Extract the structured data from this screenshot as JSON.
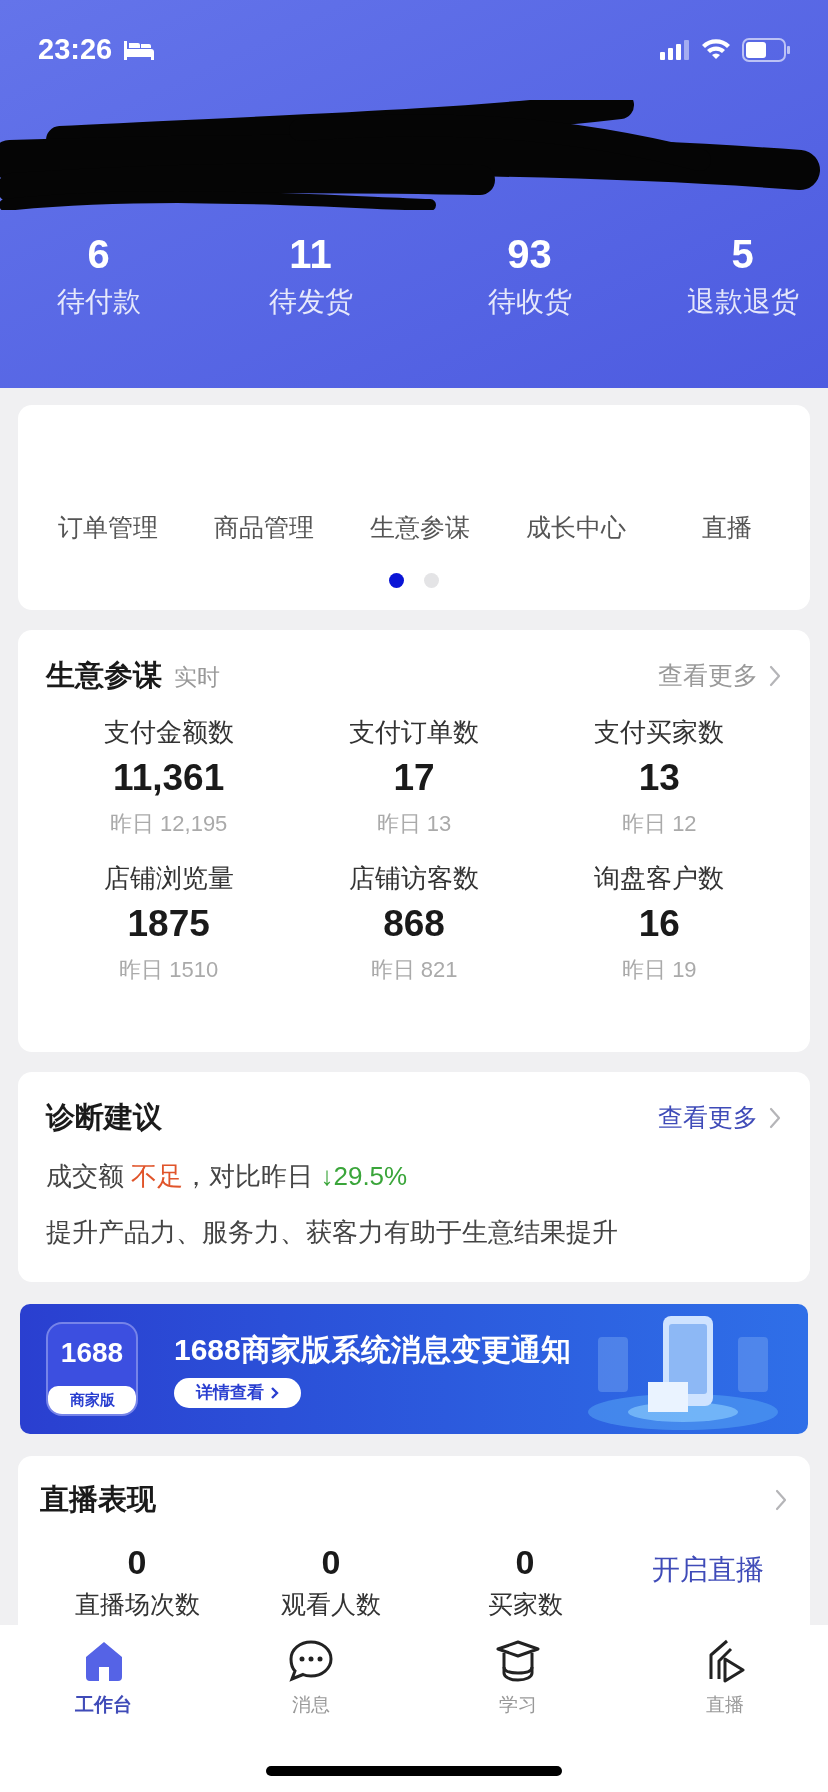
{
  "status_bar": {
    "time": "23:26"
  },
  "order_stats": [
    {
      "value": "6",
      "label": "待付款"
    },
    {
      "value": "11",
      "label": "待发货"
    },
    {
      "value": "93",
      "label": "待收货"
    },
    {
      "value": "5",
      "label": "退款退货"
    }
  ],
  "shortcuts": {
    "items": [
      "订单管理",
      "商品管理",
      "生意参谋",
      "成长中心",
      "直播"
    ],
    "pages": [
      {
        "selected": true
      },
      {
        "selected": false
      }
    ]
  },
  "business_advisor": {
    "title": "生意参谋",
    "badge": "实时",
    "more": "查看更多",
    "metrics": [
      {
        "label": "支付金额数",
        "value": "11,361",
        "yesterday": "昨日 12,195"
      },
      {
        "label": "支付订单数",
        "value": "17",
        "yesterday": "昨日 13"
      },
      {
        "label": "支付买家数",
        "value": "13",
        "yesterday": "昨日 12"
      },
      {
        "label": "店铺浏览量",
        "value": "1875",
        "yesterday": "昨日 1510"
      },
      {
        "label": "店铺访客数",
        "value": "868",
        "yesterday": "昨日 821"
      },
      {
        "label": "询盘客户数",
        "value": "16",
        "yesterday": "昨日 19"
      }
    ]
  },
  "diagnosis": {
    "title": "诊断建议",
    "more": "查看更多",
    "metric": "成交额",
    "status": "不足",
    "compare": "，对比昨日",
    "change": "↓29.5%",
    "advice": "提升产品力、服务力、获客力有助于生意结果提升"
  },
  "banner": {
    "logo_number": "1688",
    "logo_caption": "商家版",
    "title": "1688商家版系统消息变更通知",
    "button": "详情查看"
  },
  "live": {
    "title": "直播表现",
    "metrics": [
      {
        "value": "0",
        "label": "直播场次数"
      },
      {
        "value": "0",
        "label": "观看人数"
      },
      {
        "value": "0",
        "label": "买家数"
      }
    ],
    "action": "开启直播"
  },
  "tab_bar": [
    {
      "kind": "home",
      "label": "工作台",
      "selected": true
    },
    {
      "kind": "chat",
      "label": "消息",
      "selected": false
    },
    {
      "kind": "learn",
      "label": "学习",
      "selected": false
    },
    {
      "kind": "live",
      "label": "直播",
      "selected": false
    }
  ]
}
